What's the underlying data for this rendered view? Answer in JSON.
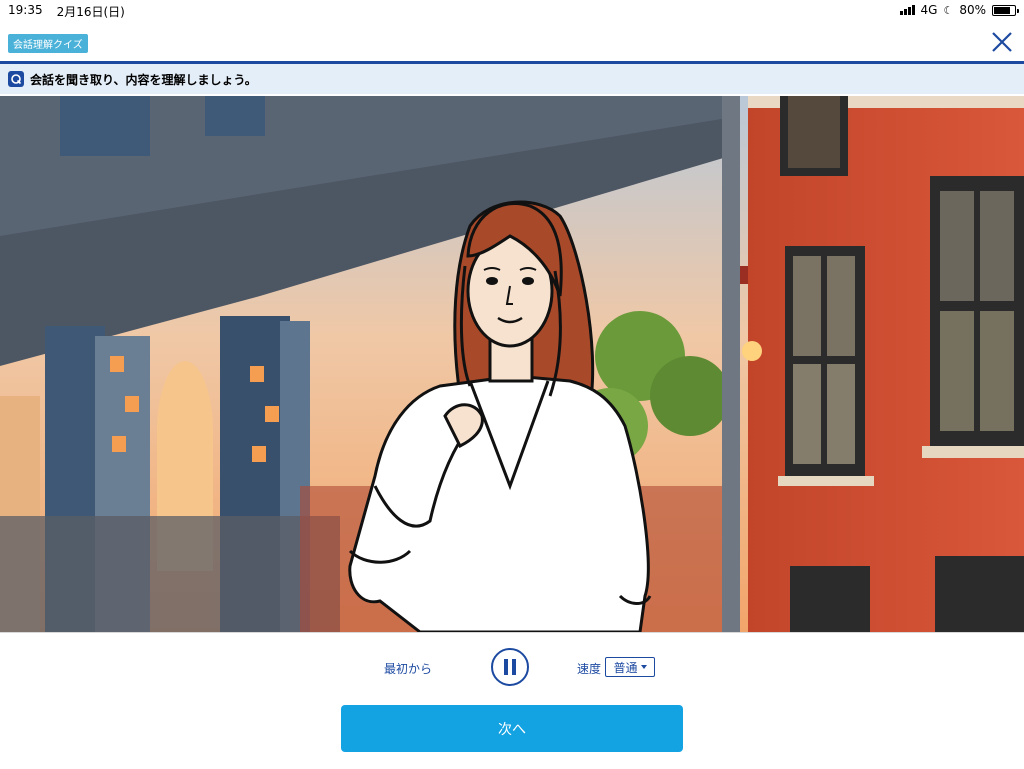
{
  "status_bar": {
    "time": "19:35",
    "date": "2月16日(日)",
    "network": "4G",
    "battery": "80%",
    "battery_level": 0.8,
    "icons": [
      "signal-icon",
      "moon-icon",
      "battery-icon"
    ]
  },
  "header": {
    "tag": "会話理解クイズ",
    "close_icon": "close-icon"
  },
  "instruction": {
    "icon": "quiz-q-icon",
    "text": "会話を聞き取り、内容を理解しましょう。"
  },
  "scene": {
    "description_icon": "character-illustration"
  },
  "controls": {
    "restart_label": "最初から",
    "pause_icon": "pause-icon",
    "speed_label": "速度",
    "speed_value": "普通",
    "next_label": "次へ"
  },
  "colors": {
    "accent": "#1d4aa1",
    "primary_button": "#13a2e2",
    "tag": "#4ab1d8",
    "instruction_bg": "#e4eef8"
  }
}
